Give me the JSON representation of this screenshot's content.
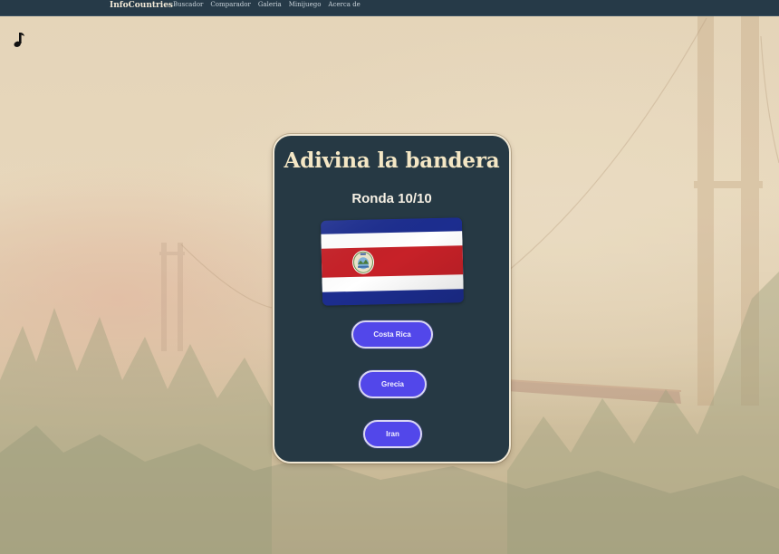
{
  "nav": {
    "brand": "InfoCountries",
    "links": [
      "Buscador",
      "Comparador",
      "Galeria",
      "Minijuego",
      "Acerca de"
    ]
  },
  "music_icon": "music-note-icon",
  "game": {
    "title": "Adivina la bandera",
    "round": "Ronda 10/10",
    "flag_icon": "costa-rica-flag",
    "answers": [
      "Costa Rica",
      "Grecia",
      "Iran"
    ]
  },
  "colors": {
    "nav_bg": "#263a48",
    "card_bg": "#263944",
    "title": "#f4e7c5",
    "button": "#5247ea"
  }
}
